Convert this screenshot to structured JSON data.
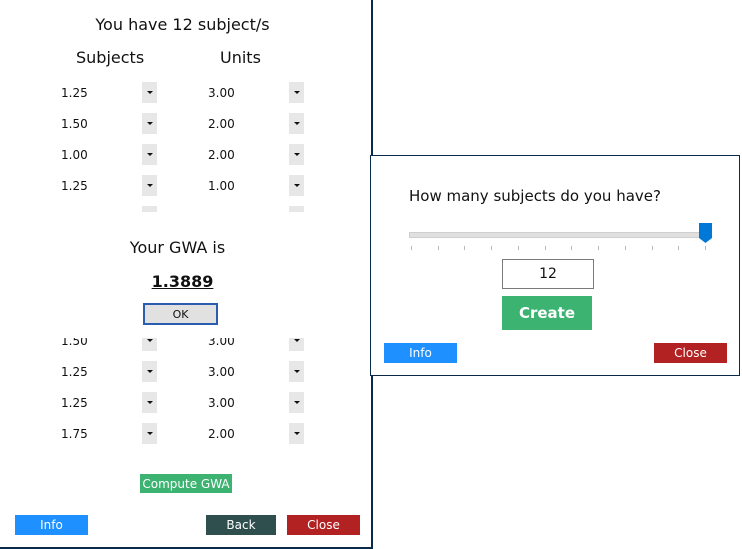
{
  "main": {
    "title": "You have 12 subject/s",
    "col_subjects": "Subjects",
    "col_units": "Units",
    "rows_top": [
      {
        "grade": "1.25",
        "units": "3.00"
      },
      {
        "grade": "1.50",
        "units": "2.00"
      },
      {
        "grade": "1.00",
        "units": "2.00"
      },
      {
        "grade": "1.25",
        "units": "1.00"
      }
    ],
    "rows_bottom": [
      {
        "grade": "1.50",
        "units": "3.00"
      },
      {
        "grade": "1.25",
        "units": "3.00"
      },
      {
        "grade": "1.25",
        "units": "3.00"
      },
      {
        "grade": "1.75",
        "units": "2.00"
      }
    ],
    "compute_label": "Compute GWA",
    "info_label": "Info",
    "back_label": "Back",
    "close_label": "Close"
  },
  "gwa": {
    "heading": "Your GWA is",
    "value": "1.3889",
    "ok_label": "OK"
  },
  "dialog": {
    "question": "How many subjects do you have?",
    "slider_value": 12,
    "input_value": "12",
    "create_label": "Create",
    "info_label": "Info",
    "close_label": "Close"
  },
  "colors": {
    "info": "#1e90ff",
    "close": "#b22222",
    "back": "#2f4f4f",
    "compute": "#3cb371",
    "create": "#3cb371",
    "slider_thumb": "#0078d7"
  }
}
